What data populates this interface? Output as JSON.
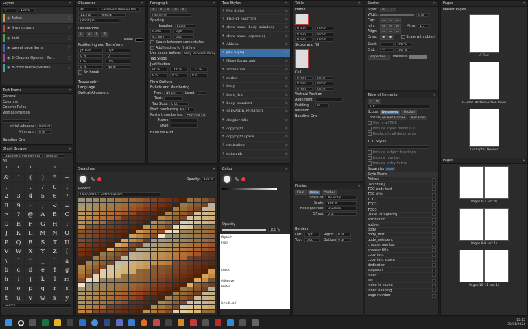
{
  "layers": {
    "title": "Layers",
    "opacity": "100 %",
    "items": [
      {
        "name": "Notes",
        "color": "#c8a040"
      },
      {
        "name": "line numbers",
        "color": "#c04040"
      },
      {
        "name": "text",
        "color": "#40a060"
      },
      {
        "name": "parent page items",
        "color": "#4060c0"
      },
      {
        "name": "C-Chapter Opener - 'Pa...",
        "color": "#a040a0"
      },
      {
        "name": "B-Front Matter/Section...",
        "color": "#40a0a0"
      }
    ]
  },
  "text_frame": {
    "title": "Text Frame",
    "items": [
      "General",
      "Columns",
      "Column Rules",
      "Vertical Position"
    ],
    "initial_label": "Initial advance:",
    "initial_value": "Default",
    "minimum_label": "Minimum:",
    "minimum_value": "0 pt",
    "baseline_grid": "Baseline Grid"
  },
  "glyph": {
    "title": "Glyph Browser",
    "font": "Garamond Premier Pro",
    "style": "Regular",
    "filter": "All",
    "glyphs": [
      "'",
      "\"",
      "'",
      "'",
      "'",
      "'",
      "&",
      "'",
      "(",
      ")",
      "*",
      "+",
      ",",
      "-",
      ".",
      "/",
      "0",
      "1",
      "2",
      "3",
      "4",
      "5",
      "6",
      "7",
      "8",
      "9",
      ":",
      ";",
      "<",
      "=",
      ">",
      "?",
      "@",
      "A",
      "B",
      "C",
      "D",
      "E",
      "F",
      "G",
      "H",
      "I",
      "J",
      "K",
      "L",
      "M",
      "N",
      "O",
      "P",
      "Q",
      "R",
      "S",
      "T",
      "U",
      "V",
      "W",
      "X",
      "Y",
      "Z",
      "[",
      "\\",
      "]",
      "^",
      "_",
      "`",
      "a",
      "b",
      "c",
      "d",
      "e",
      "f",
      "g",
      "h",
      "i",
      "j",
      "k",
      "l",
      "m",
      "n",
      "o",
      "p",
      "q",
      "r",
      "s",
      "t",
      "u",
      "v",
      "w",
      "x",
      "y",
      "z",
      "{",
      "|",
      "}",
      "~",
      "¡"
    ],
    "search_placeholder": "Search"
  },
  "character": {
    "title": "Character",
    "language": "All",
    "font": "Garamond Premier Pro",
    "size": "11.5 pt",
    "style": "Regular",
    "no_style": "[No Style]",
    "decorations": "Decorations",
    "none": "None",
    "positioning": "Positioning and Transform",
    "pos_rows": [
      [
        "pt Text",
        "0 pt"
      ],
      [
        "0 %",
        "0 °"
      ],
      [
        "0 %",
        "0 %"
      ],
      [
        "0 %",
        "None"
      ]
    ],
    "no_break": "No break",
    "typography": "Typography",
    "language_sec": "Language",
    "optical": "Optical Alignment"
  },
  "paragraph": {
    "title": "Paragraph",
    "no_style": "[No Style]",
    "spacing": "Spacing",
    "leading_label": "Leading:",
    "leading_value": "Exact",
    "space_between": "Space between same styles",
    "add_leading": "Add leading to first line",
    "use_space": "Use space before:",
    "use_space_value": "Only Between Paragraphs",
    "tab_stops": "Tab Stops",
    "justification": "Justification",
    "justify_rows": [
      [
        "80 %",
        "100 %",
        "133 %"
      ],
      [
        "0 %",
        "0 %",
        "0 %"
      ]
    ],
    "flow_options": "Flow Options",
    "bullets": "Bullets and Numbering",
    "type_label": "Type:",
    "type_value": "No List",
    "level_label": "Level:",
    "level_value": "1",
    "text_label": "Text:",
    "tab_stop_label": "Tab Stop:",
    "start_label": "Start numbering at:",
    "start_value": "1",
    "restart_label": "Restart numbering:",
    "restart_value": "Any new List",
    "name_label": "Name:",
    "style_label": "Style:",
    "baseline": "Baseline Grid"
  },
  "text_styles": {
    "title": "Text Styles",
    "items": [
      {
        "name": "[No Style]",
        "sel": false
      },
      {
        "name": "FRONT MATTER",
        "sel": false
      },
      {
        "name": "show-name (body_noindex)",
        "sel": false
      },
      {
        "name": "show-name (separate)",
        "sel": false
      },
      {
        "name": "Ahlena",
        "sel": false
      },
      {
        "name": "[No Style]",
        "sel": true
      },
      {
        "name": "[Base Paragraph]",
        "sel": false
      },
      {
        "name": "attribution",
        "sel": false
      },
      {
        "name": "author",
        "sel": false
      },
      {
        "name": "body",
        "sel": false
      },
      {
        "name": "body_first",
        "sel": false
      },
      {
        "name": "body_noindent",
        "sel": false
      },
      {
        "name": "CHAPTER_NUMBER",
        "sel": false
      },
      {
        "name": "chapter_title",
        "sel": false
      },
      {
        "name": "copyright",
        "sel": false
      },
      {
        "name": "copyright space",
        "sel": false
      },
      {
        "name": "dedication",
        "sel": false
      },
      {
        "name": "epigraph",
        "sel": false
      }
    ]
  },
  "table": {
    "title": "Table",
    "frame": "Frame",
    "stroke_fill": "Stroke and Fill",
    "cell": "Cell",
    "vertical_pos": "Vertical Position",
    "alignment_label": "Alignment:",
    "padding_label": "Padding:",
    "rotation": "Rotation",
    "baseline_grid": "Baseline Grid",
    "shape": "Shape",
    "size_values": [
      "0 mm",
      "0 mm",
      "0 mm"
    ]
  },
  "pinning": {
    "title": "Pinning",
    "tabs": [
      "Float",
      "Inline",
      "Anchor"
    ],
    "scale_to": "Scale to:",
    "scale_to_value": "No Scale",
    "scale": "Scale:",
    "scale_value": "100 %",
    "base_pos": "Base position:",
    "base_pos_value": "Baseline",
    "offset": "Offset:",
    "offset_value": "0 pt",
    "borders": "Borders",
    "left": "Left:",
    "right": "Right:",
    "top": "Top:",
    "bottom": "Bottom:",
    "border_val": "0 pt"
  },
  "swatches": {
    "title": "Swatches",
    "opacity_label": "Opacity:",
    "opacity_value": "100 %",
    "recent": "Recent",
    "palette": "Pale/CMYK + CMYK Custom"
  },
  "colour": {
    "title": "Colour",
    "opacity_label": "Opacity",
    "opacity_value": "100 %",
    "story_lines": [
      "fbpolish",
      "Front",
      "",
      "",
      "",
      "",
      "check",
      "",
      "Adhesive",
      "Poster",
      "",
      "",
      "ity-LBL.pdf"
    ]
  },
  "stroke": {
    "title": "Stroke",
    "style_label": "Style:",
    "width_label": "Width:",
    "width_value": "0 pt",
    "cap_label": "Cap:",
    "join_label": "Join:",
    "mitre_label": "Mitre:",
    "mitre_value": "1.5",
    "align_label": "Align:",
    "draw_label": "Draw:",
    "scale_label": "Scale with object",
    "start_label": "Start:",
    "end_label": "End:",
    "properties_btn": "Properties...",
    "pressure_label": "Pressure"
  },
  "toc": {
    "title": "Table of Contents",
    "toc_label": "TOC",
    "scope_label": "Scope:",
    "scope_doc": "Document",
    "scope_sec": "Section",
    "look_in": "Look in:",
    "all_text": "All Text Frames",
    "text_flow": "Text Flow",
    "options": [
      "Use in all TOC",
      "Include styles below TOC",
      "Replace in all documents"
    ],
    "toc_styles": "TOC Styles",
    "entry_options": [
      "Include subject headings",
      "Include number",
      "Include entry in the"
    ],
    "separator_label": "Separator:",
    "style_name": "Style Name",
    "style_list": [
      "Ahlena",
      "[No Style]",
      "TOC body text",
      "TOC title",
      "TOC1",
      "TOC2",
      "TOC3",
      "[Base Paragraph]",
      "attribution",
      "author",
      "body",
      "body_first",
      "body_noindent",
      "chapter number",
      "chapter title",
      "copyright",
      "copyright space",
      "dedication",
      "epigraph",
      "index",
      "toc",
      "index to caveo",
      "index heading",
      "page number"
    ]
  },
  "pages": {
    "title": "Pages",
    "master": "Master Pages",
    "masters": [
      {
        "label": "A-Text"
      },
      {
        "label": "B-Front Matter/Section Open"
      },
      {
        "label": "C-Chapter Opener"
      }
    ],
    "pages_title": "Pages",
    "spreads": [
      {
        "label": "Pages 6-7 (sct 4)"
      },
      {
        "label": "Pages 8-9 (sct 1)"
      },
      {
        "label": "Pages 10-11 (sct 1)"
      }
    ]
  },
  "taskbar": {
    "time": "15:15",
    "date": "30/01/2024"
  }
}
